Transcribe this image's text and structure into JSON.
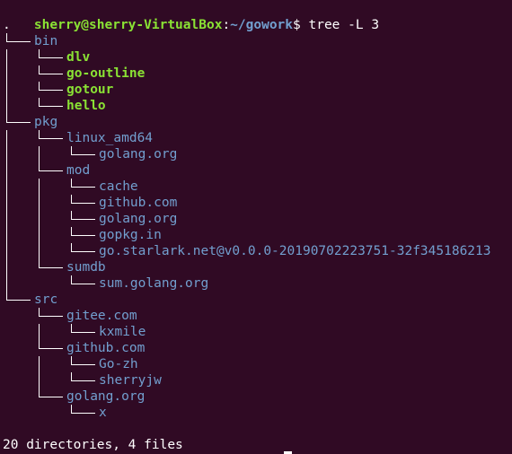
{
  "prompt": {
    "user_host": "sherry@sherry-VirtualBox",
    "separator": ":",
    "path": "~/gowork",
    "dollar": "$",
    "command": " tree -L 3"
  },
  "root": ".",
  "entries": [
    {
      "name": "bin",
      "depth": 1,
      "kind": "dir",
      "last": false
    },
    {
      "name": "dlv",
      "depth": 2,
      "kind": "exe",
      "last": false
    },
    {
      "name": "go-outline",
      "depth": 2,
      "kind": "exe",
      "last": false
    },
    {
      "name": "gotour",
      "depth": 2,
      "kind": "exe",
      "last": false
    },
    {
      "name": "hello",
      "depth": 2,
      "kind": "exe",
      "last": true
    },
    {
      "name": "pkg",
      "depth": 1,
      "kind": "dir",
      "last": false
    },
    {
      "name": "linux_amd64",
      "depth": 2,
      "kind": "dir",
      "last": false
    },
    {
      "name": "golang.org",
      "depth": 3,
      "kind": "dir",
      "last": true
    },
    {
      "name": "mod",
      "depth": 2,
      "kind": "dir",
      "last": false
    },
    {
      "name": "cache",
      "depth": 3,
      "kind": "dir",
      "last": false
    },
    {
      "name": "github.com",
      "depth": 3,
      "kind": "dir",
      "last": false
    },
    {
      "name": "golang.org",
      "depth": 3,
      "kind": "dir",
      "last": false
    },
    {
      "name": "gopkg.in",
      "depth": 3,
      "kind": "dir",
      "last": false
    },
    {
      "name": "go.starlark.net@v0.0.0-20190702223751-32f345186213",
      "depth": 3,
      "kind": "dir",
      "last": true
    },
    {
      "name": "sumdb",
      "depth": 2,
      "kind": "dir",
      "last": true
    },
    {
      "name": "sum.golang.org",
      "depth": 3,
      "kind": "dir",
      "last": true
    },
    {
      "name": "src",
      "depth": 1,
      "kind": "dir",
      "last": true
    },
    {
      "name": "gitee.com",
      "depth": 2,
      "kind": "dir",
      "last": false
    },
    {
      "name": "kxmile",
      "depth": 3,
      "kind": "dir",
      "last": true
    },
    {
      "name": "github.com",
      "depth": 2,
      "kind": "dir",
      "last": false
    },
    {
      "name": "Go-zh",
      "depth": 3,
      "kind": "dir",
      "last": false
    },
    {
      "name": "sherryjw",
      "depth": 3,
      "kind": "dir",
      "last": true
    },
    {
      "name": "golang.org",
      "depth": 2,
      "kind": "dir",
      "last": true
    },
    {
      "name": "x",
      "depth": 3,
      "kind": "dir",
      "last": true
    }
  ],
  "summary": "20 directories, 4 files",
  "colors": {
    "background": "#300a24",
    "prompt_user": "#8ae234",
    "prompt_path": "#729fcf",
    "directory": "#729fcf",
    "executable": "#8ae234",
    "text": "#ffffff"
  }
}
